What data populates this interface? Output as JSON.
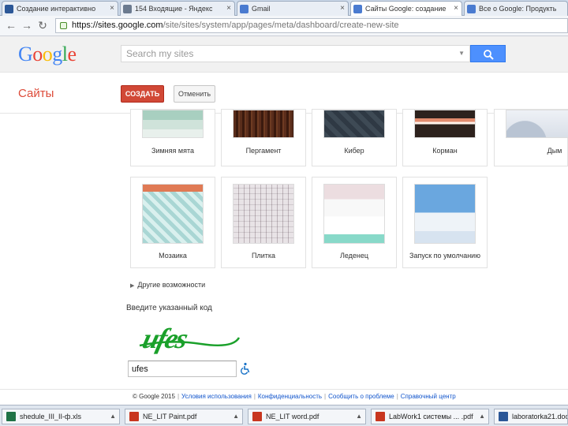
{
  "browser": {
    "tabs": [
      {
        "title": "Создание интерактивно",
        "icon": "document-icon",
        "color": "#2b5797"
      },
      {
        "title": "154 Входящие - Яндекс",
        "icon": "mail-icon",
        "color": "#6b7a8f"
      },
      {
        "title": "Gmail",
        "icon": "google-icon",
        "color": "#4a7bd0"
      },
      {
        "title": "Сайты Google: создание",
        "icon": "sites-icon",
        "color": "#4a7bd0"
      },
      {
        "title": "Все о Google: Продукты",
        "icon": "google-icon",
        "color": "#4a7bd0"
      }
    ],
    "url_host": "https://sites.google.com",
    "url_path": "/site/sites/system/app/pages/meta/dashboard/create-new-site"
  },
  "header": {
    "logo": "Google",
    "search_placeholder": "Search my sites"
  },
  "sites_bar": {
    "title": "Сайты",
    "create_label": "СОЗДАТЬ",
    "cancel_label": "Отменить"
  },
  "themes": {
    "row1": [
      {
        "label": "Зимняя мята",
        "swatch": "t-winter"
      },
      {
        "label": "Пергамент",
        "swatch": "t-parchment"
      },
      {
        "label": "Кибер",
        "swatch": "t-cyber"
      },
      {
        "label": "Корман",
        "swatch": "t-koram"
      },
      {
        "label": "Дым",
        "swatch": "t-dim"
      }
    ],
    "row2": [
      {
        "label": "Мозаика",
        "swatch": "t-mosaic"
      },
      {
        "label": "Плитка",
        "swatch": "t-tile"
      },
      {
        "label": "Леденец",
        "swatch": "t-ice"
      },
      {
        "label": "Запуск по умолчанию",
        "swatch": "t-default"
      }
    ]
  },
  "more_options": "Другие возможности",
  "captcha": {
    "label": "Введите указанный код",
    "image_text": "ufes",
    "input_value": "ufes"
  },
  "footer": {
    "copyright": "© Google 2015",
    "links": [
      "Условия использования",
      "Конфиденциальность",
      "Сообщить о проблеме",
      "Справочный центр"
    ]
  },
  "downloads": [
    {
      "name": "shedule_III_II-ф.xls",
      "color": "#1f7246"
    },
    {
      "name": "NE_LIT Paint.pdf",
      "color": "#c8361f"
    },
    {
      "name": "NE_LIT word.pdf",
      "color": "#c8361f"
    },
    {
      "name": "LabWork1 системы ... .pdf",
      "color": "#c8361f"
    },
    {
      "name": "laboratorka21.doc",
      "color": "#2b5797"
    }
  ],
  "colors": {
    "google_blue": "#4285f4",
    "google_red": "#ea4335",
    "google_yellow": "#fbbc05",
    "google_green": "#34a853",
    "create_red": "#d14836",
    "captcha_green": "#1aa02a"
  }
}
